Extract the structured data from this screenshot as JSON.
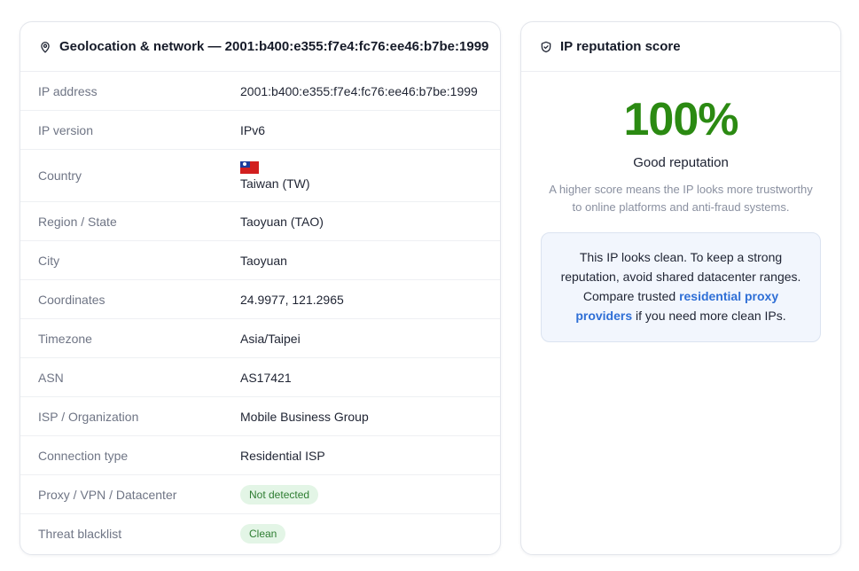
{
  "geolocation": {
    "header_title": "Geolocation & network — 2001:b400:e355:f7e4:fc76:ee46:b7be:1999",
    "header_icon": "map-pin-icon",
    "rows": [
      {
        "key": "IP address",
        "value": "2001:b400:e355:f7e4:fc76:ee46:b7be:1999"
      },
      {
        "key": "IP version",
        "value": "IPv6"
      },
      {
        "key": "Country",
        "value": "Taiwan (TW)",
        "icon": "taiwan-flag-icon"
      },
      {
        "key": "Region / State",
        "value": "Taoyuan (TAO)"
      },
      {
        "key": "City",
        "value": "Taoyuan"
      },
      {
        "key": "Coordinates",
        "value": "24.9977, 121.2965"
      },
      {
        "key": "Timezone",
        "value": "Asia/Taipei"
      },
      {
        "key": "ASN",
        "value": "AS17421"
      },
      {
        "key": "ISP / Organization",
        "value": "Mobile Business Group"
      },
      {
        "key": "Connection type",
        "value": "Residential ISP"
      },
      {
        "key": "Proxy / VPN / Datacenter",
        "value": "Not detected"
      },
      {
        "key": "Threat blacklist",
        "value": "Clean"
      }
    ]
  },
  "reputation": {
    "header_title": "IP reputation score",
    "header_icon": "shield-check-icon",
    "score": "100%",
    "score_color": "#2b8a12",
    "verdict": "Good reputation",
    "description": "A higher score means the IP looks more trustworthy to online platforms and anti-fraud systems.",
    "notice": {
      "text_before": "This IP looks clean. To keep a strong reputation, avoid shared datacenter ranges. Compare trusted ",
      "link_text": "residential proxy providers",
      "text_after": " if you need more clean IPs."
    }
  },
  "colors": {
    "accent_link": "#2f6fd6",
    "badge_bg": "#e3f5e6",
    "badge_text": "#2e7d32"
  }
}
